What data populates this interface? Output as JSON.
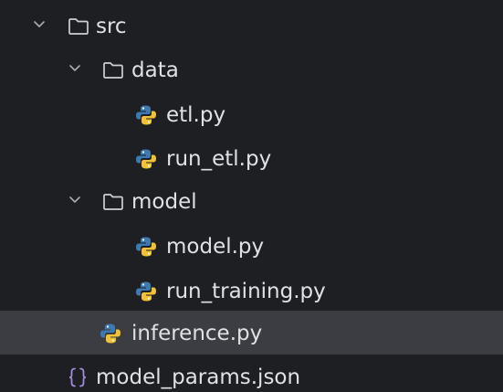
{
  "project_tree": {
    "items": [
      {
        "id": "src",
        "label": "src",
        "kind": "folder",
        "expanded": true,
        "icon": "folder-icon"
      },
      {
        "id": "data",
        "label": "data",
        "kind": "folder",
        "expanded": true,
        "icon": "folder-icon"
      },
      {
        "id": "etl",
        "label": "etl.py",
        "kind": "python-file",
        "icon": "python-file-icon"
      },
      {
        "id": "run_etl",
        "label": "run_etl.py",
        "kind": "python-file",
        "icon": "python-file-icon"
      },
      {
        "id": "model",
        "label": "model",
        "kind": "folder",
        "expanded": true,
        "icon": "folder-icon"
      },
      {
        "id": "model_py",
        "label": "model.py",
        "kind": "python-file",
        "icon": "python-file-icon"
      },
      {
        "id": "run_training",
        "label": "run_training.py",
        "kind": "python-file",
        "icon": "python-file-icon"
      },
      {
        "id": "inference",
        "label": "inference.py",
        "kind": "python-file",
        "icon": "python-file-icon",
        "selected": true
      },
      {
        "id": "model_params",
        "label": "model_params.json",
        "kind": "json-file",
        "icon": "json-file-icon"
      }
    ]
  },
  "colors": {
    "background": "#1e1f22",
    "selected_row": "#3b3d42",
    "text": "#dfe1e5",
    "folder_outline": "#ced0d6",
    "python_blue": "#3d7ab3",
    "python_yellow": "#f2c233",
    "json_brace": "#a08be0"
  }
}
